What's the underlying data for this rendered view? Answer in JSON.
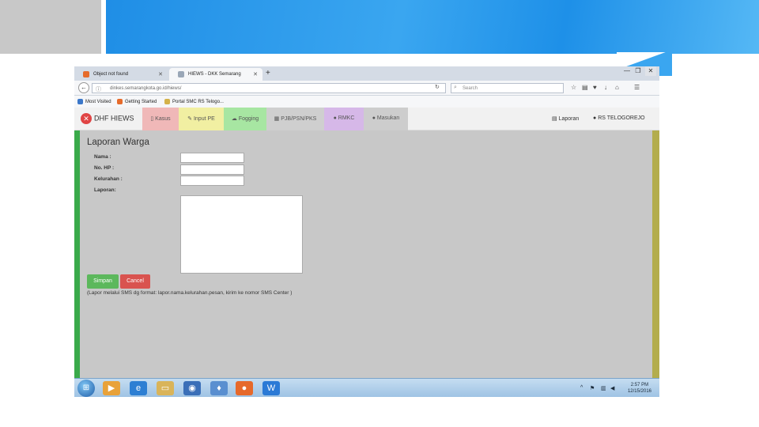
{
  "browser": {
    "tabs": [
      {
        "label": "Object not found"
      },
      {
        "label": "HIEWS - DKK Semarang"
      }
    ],
    "new_tab": "+",
    "window_controls": [
      "—",
      "❐",
      "✕"
    ],
    "url": "dinkes.semarangkota.go.id/hiews/",
    "search_placeholder": "Search",
    "bookmarks": [
      {
        "label": "Most Visited"
      },
      {
        "label": "Getting Started"
      },
      {
        "label": "Portal SMC RS Telogo..."
      }
    ]
  },
  "app": {
    "brand": "DHF HIEWS",
    "menu": [
      {
        "label": "Kasus"
      },
      {
        "label": "Input PE"
      },
      {
        "label": "Fogging"
      },
      {
        "label": "PJB/PSN/PKS"
      },
      {
        "label": "RMKC"
      },
      {
        "label": "Masukan"
      }
    ],
    "right_links": [
      {
        "label": "Laporan"
      },
      {
        "label": "RS TELOGOREJO"
      }
    ]
  },
  "form": {
    "title": "Laporan Warga",
    "fields": [
      {
        "label": "Nama :"
      },
      {
        "label": "No. HP :"
      },
      {
        "label": "Kelurahan :"
      },
      {
        "label": "Laporan:"
      }
    ],
    "save_label": "Simpan",
    "cancel_label": "Cancel",
    "note": "(Lapor melalui SMS dg format: lapor.nama.kelurahan.pesan, kirim ke nomor SMS Center )"
  },
  "taskbar": {
    "time": "2:57 PM",
    "date": "12/15/2016"
  },
  "colors": {
    "accent_blue": "#1f8ee6",
    "green_bar": "#3aaa4a",
    "yellow_bar": "#b3ad4d",
    "save": "#5cb85c",
    "cancel": "#d9534f"
  }
}
